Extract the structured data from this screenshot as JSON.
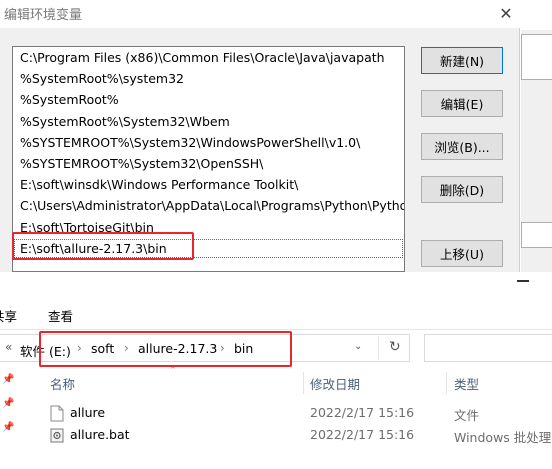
{
  "dialog": {
    "title": "编辑环境变量",
    "close_glyph": "✕",
    "paths": [
      "C:\\Program Files (x86)\\Common Files\\Oracle\\Java\\javapath",
      "%SystemRoot%\\system32",
      "%SystemRoot%",
      "%SystemRoot%\\System32\\Wbem",
      "%SYSTEMROOT%\\System32\\WindowsPowerShell\\v1.0\\",
      "%SYSTEMROOT%\\System32\\OpenSSH\\",
      "E:\\soft\\winsdk\\Windows Performance Toolkit\\",
      "C:\\Users\\Administrator\\AppData\\Local\\Programs\\Python\\Pytho...",
      "E:\\soft\\TortoiseGit\\bin",
      "E:\\soft\\allure-2.17.3\\bin"
    ],
    "buttons": {
      "new": "新建(N)",
      "edit": "编辑(E)",
      "browse": "浏览(B)...",
      "delete": "删除(D)",
      "move_up": "上移(U)"
    }
  },
  "explorer": {
    "ribbon": {
      "share": "共享",
      "view": "查看"
    },
    "address": {
      "back_glyph": "«",
      "root": "软件 (E:)",
      "parts": [
        "soft",
        "allure-2.17.3",
        "bin"
      ],
      "separator": "›",
      "dropdown_glyph": "⌄",
      "refresh_glyph": "↻"
    },
    "columns": {
      "name": "名称",
      "date": "修改日期",
      "type": "类型"
    },
    "files": [
      {
        "name": "allure",
        "date": "2022/2/17 15:16",
        "type": "文件",
        "icon": "blank-file-icon"
      },
      {
        "name": "allure.bat",
        "date": "2022/2/17 15:16",
        "type": "Windows 批处理...",
        "icon": "batch-file-icon"
      }
    ]
  },
  "colors": {
    "highlight": "#e8262c",
    "dialog_bg": "#f0f0f0",
    "button_bg": "#e1e1e1",
    "focus_border": "#0078d7",
    "column_header": "#4c607a"
  }
}
